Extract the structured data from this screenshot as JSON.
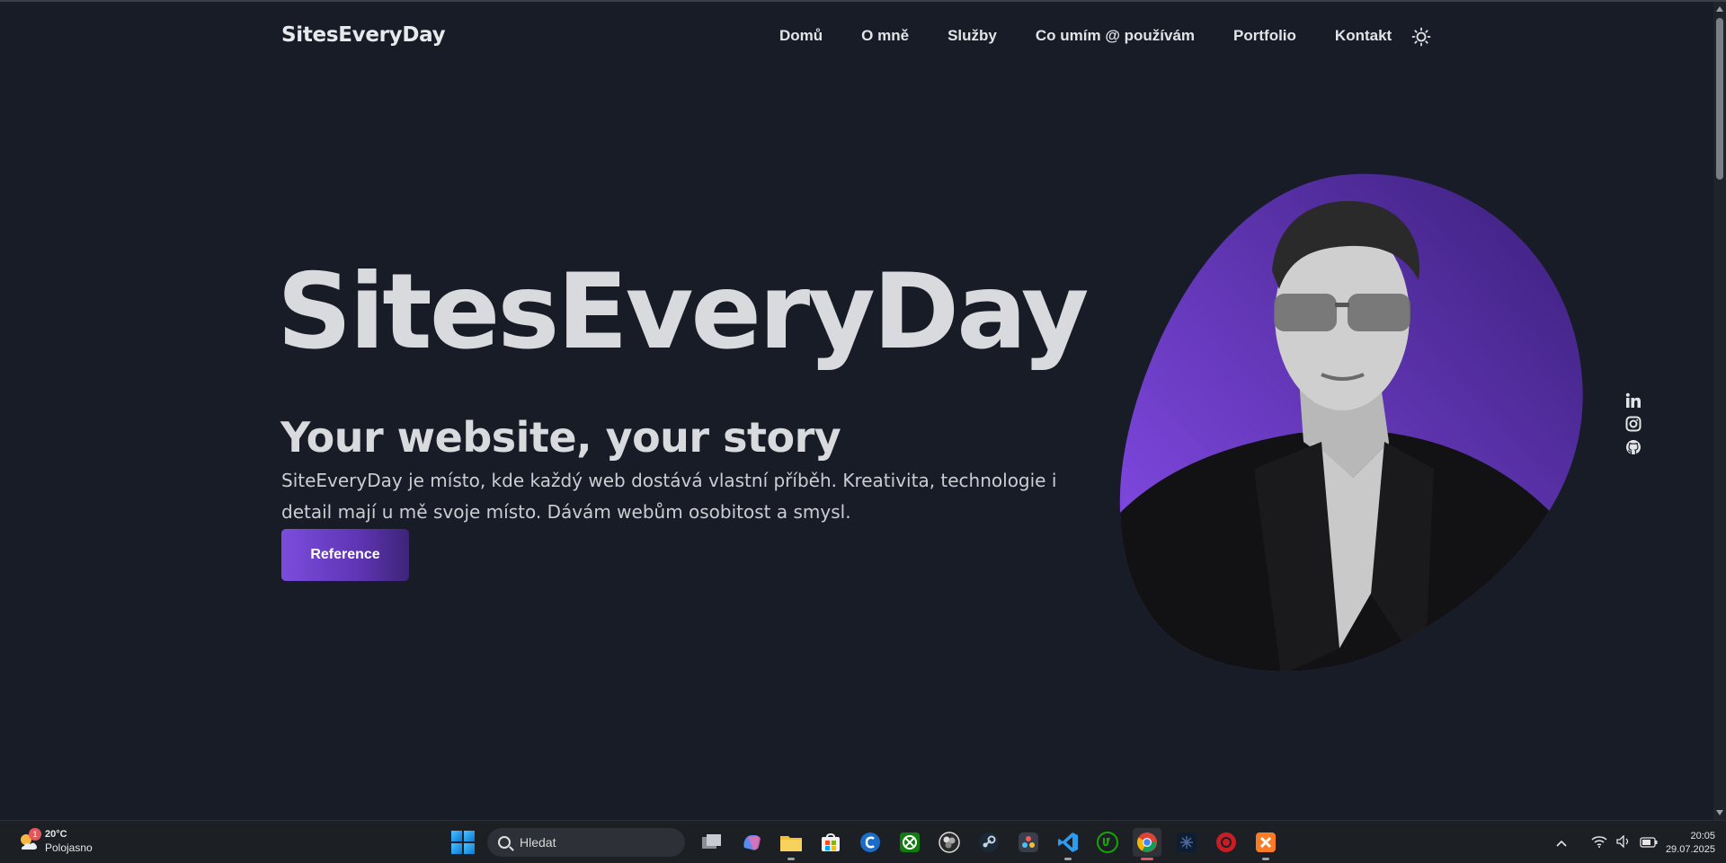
{
  "site": {
    "logo": "SitesEveryDay",
    "nav": [
      "Domů",
      "O mně",
      "Služby",
      "Co umím @ používám",
      "Portfolio",
      "Kontakt"
    ],
    "theme_toggle_icon": "sun-icon"
  },
  "hero": {
    "title": "SitesEveryDay",
    "subtitle": "Your website, your story",
    "description": "SiteEveryDay je místo, kde každý web dostává vlastní příběh. Kreativita, technologie i detail mají u mě svoje místo. Dávám webům osobitost a smysl.",
    "cta": "Reference",
    "portrait_gradient": [
      "#8a4ef0",
      "#3a1f7a"
    ]
  },
  "social": [
    "linkedin-icon",
    "instagram-icon",
    "github-icon"
  ],
  "taskbar": {
    "weather": {
      "temp": "20°C",
      "condition": "Polojasno",
      "badge": "1"
    },
    "search_placeholder": "Hledat",
    "apps": [
      "task-view",
      "copilot",
      "file-explorer",
      "microsoft-store",
      "ccleaner",
      "xbox",
      "obs",
      "steam",
      "davinci-resolve",
      "vscode",
      "upwork",
      "chrome",
      "app-dark",
      "app-red",
      "xampp"
    ],
    "clock": {
      "time": "20:05",
      "date": "29.07.2025"
    }
  },
  "colors": {
    "page_bg": "#171c26",
    "accent": "#7c4ddc",
    "text": "#d9dade"
  }
}
